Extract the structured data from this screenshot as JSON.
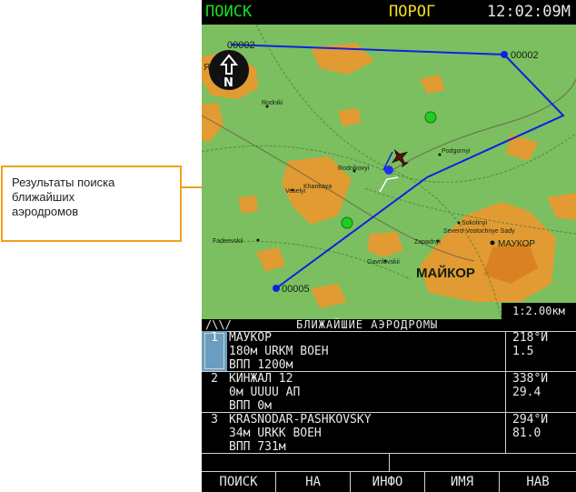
{
  "callout": {
    "text_line1": "Результаты поиска",
    "text_line2": "ближайших",
    "text_line3": "аэродромов"
  },
  "topbar": {
    "mode": "ПОИСК",
    "status": "ПОРОГ",
    "clock": "12:02:09М"
  },
  "map": {
    "north_letter": "N",
    "waypoints": [
      "00002",
      "00002",
      "00005"
    ],
    "towns": [
      "Rodniki",
      "Podgornyi",
      "Rodnikovyi",
      "Veselyi",
      "Khankaya",
      "Sokolinyi",
      "Severo-Vostochnye Sady",
      "Zapadnyi",
      "Fadeevskii",
      "Gavrilovskii"
    ],
    "city_large": "МАЙКОР",
    "city_marker": "МАУКОР",
    "city_partial": "ЯЕНSK",
    "scale": "1:2.00км"
  },
  "list": {
    "scroll_indicator": "/\\\\/",
    "title": "БЛИЖАЙШИЕ АЭРОДРОМЫ",
    "rows": [
      {
        "index": "1",
        "name": "МАУКОР",
        "line2": "180м URKM ВОЕН",
        "line3": "ВПП 1200м",
        "bearing": "218°И",
        "distance": "1.5"
      },
      {
        "index": "2",
        "name": "КИНЖАЛ 12",
        "line2": "0м UUUU АП",
        "line3": "ВПП 0м",
        "bearing": "338°И",
        "distance": "29.4"
      },
      {
        "index": "3",
        "name": "KRASNODAR-PASHKOVSKY",
        "line2": "34м URKK ВОЕН",
        "line3": "ВПП 731м",
        "bearing": "294°И",
        "distance": "81.0"
      }
    ]
  },
  "softkeys": [
    "ПОИСК",
    "НА",
    "ИНФО",
    "ИМЯ",
    "НАВ"
  ],
  "colors": {
    "mode_green": "#18e020",
    "status_yellow": "#f5e020",
    "route_blue": "#1020e0",
    "callout_orange": "#f0a020",
    "selected_row": "#6a9ec0"
  }
}
